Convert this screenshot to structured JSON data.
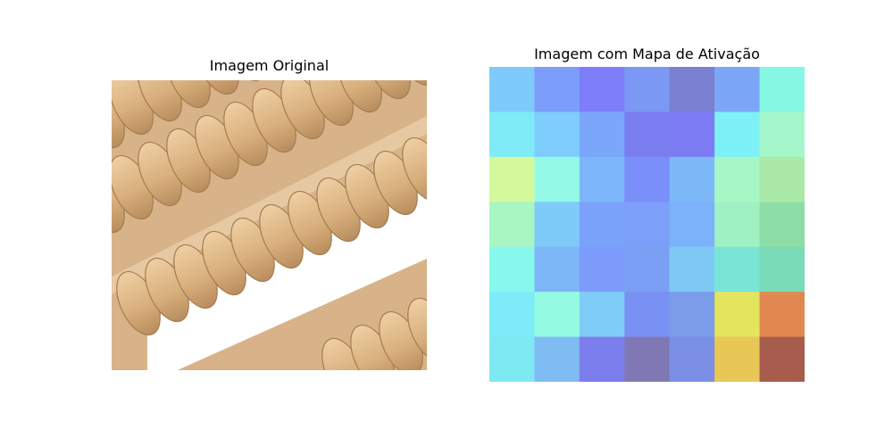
{
  "figure": {
    "left_title": "Imagem Original",
    "right_title": "Imagem com Mapa de Ativação"
  },
  "chart_data": [
    {
      "type": "image",
      "title": "Imagem Original",
      "content": "wooden roller massager"
    },
    {
      "type": "heatmap",
      "title": "Imagem com Mapa de Ativação",
      "rows": 7,
      "cols": 7,
      "cell_colors": [
        [
          "#7ecbfb",
          "#7c9efa",
          "#7e7dfa",
          "#7b98f4",
          "#7b80d2",
          "#7ca6f8",
          "#86f7e3"
        ],
        [
          "#7eebf6",
          "#7ecdfc",
          "#7ba7fa",
          "#7a7def",
          "#7c7bf3",
          "#7ef1f7",
          "#a4f6cb"
        ],
        [
          "#d4f99c",
          "#94fae5",
          "#7eb6fb",
          "#7a8ffa",
          "#7db8f9",
          "#a6f6c6",
          "#abe9a8"
        ],
        [
          "#a9f6c2",
          "#7ecbfa",
          "#7ba2fb",
          "#7c9ffa",
          "#7cb2f9",
          "#9ff0c3",
          "#8ddea6"
        ],
        [
          "#86f9ec",
          "#7eb7f8",
          "#7d9bfa",
          "#7c9ff6",
          "#7ec9f4",
          "#7ae5d5",
          "#79dbb7"
        ],
        [
          "#7eebf8",
          "#94fae1",
          "#7fcdf6",
          "#7a91f4",
          "#7a9ce9",
          "#e2e55d",
          "#e08850"
        ],
        [
          "#7fe9f3",
          "#7fbcf4",
          "#7b7eec",
          "#7f78b5",
          "#7b8fe4",
          "#e8c757",
          "#a75c4d"
        ]
      ]
    }
  ]
}
